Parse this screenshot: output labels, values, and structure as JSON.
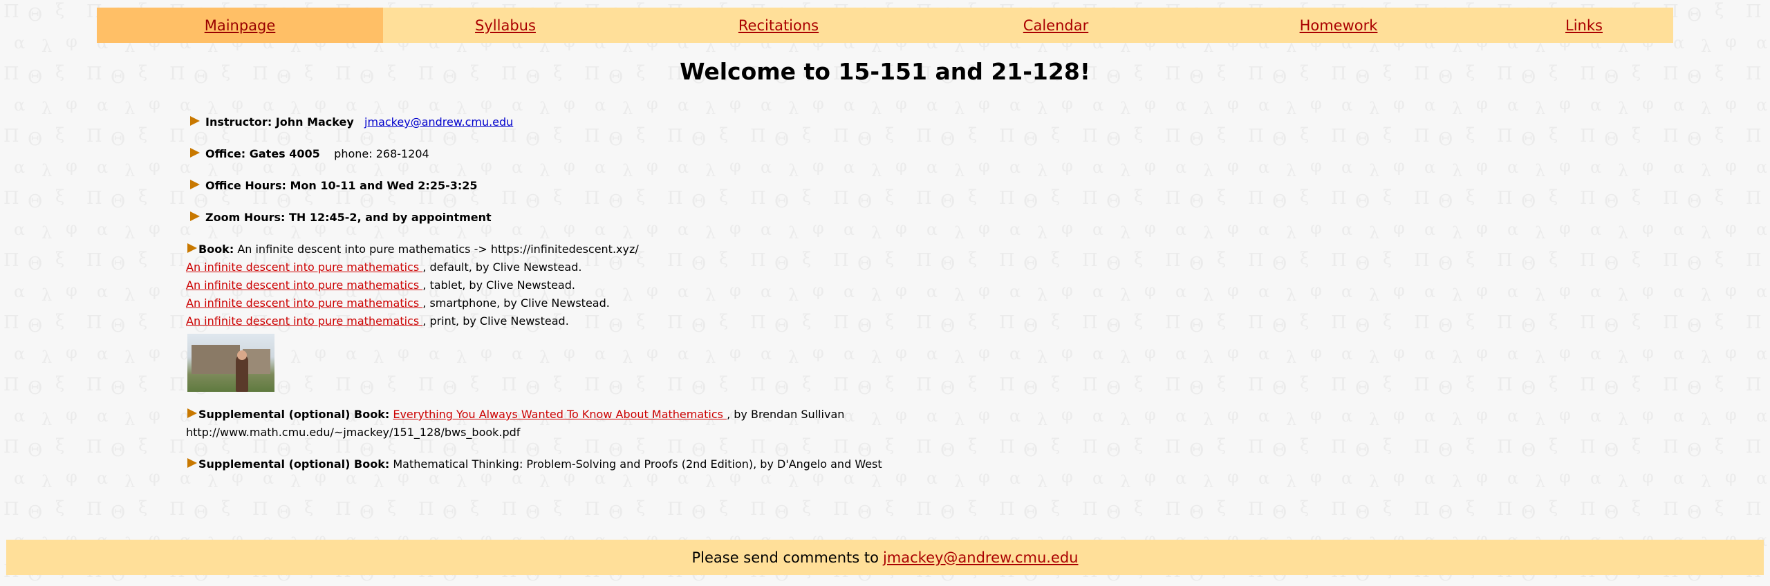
{
  "nav": {
    "items": [
      {
        "label": "Mainpage",
        "active": true
      },
      {
        "label": "Syllabus",
        "active": false
      },
      {
        "label": "Recitations",
        "active": false
      },
      {
        "label": "Calendar",
        "active": false
      },
      {
        "label": "Homework",
        "active": false
      },
      {
        "label": "Links",
        "active": false
      }
    ]
  },
  "page": {
    "title": "Welcome to 15-151 and 21-128!"
  },
  "info": {
    "instructor_label": "Instructor: John Mackey",
    "instructor_email": "jmackey@andrew.cmu.edu",
    "office_label": "Office: Gates 4005",
    "office_phone": "phone: 268-1204",
    "office_hours": "Office Hours: Mon 10-11 and Wed 2:25-3:25",
    "zoom_hours": "Zoom Hours: TH 12:45-2, and by appointment",
    "book_label": "Book:",
    "book_text": "An infinite descent into pure mathematics -> https://infinitedescent.xyz/",
    "book_links": [
      {
        "link": "An infinite descent into pure mathematics ",
        "suffix": ", default, by Clive Newstead."
      },
      {
        "link": "An infinite descent into pure mathematics ",
        "suffix": ", tablet, by Clive Newstead."
      },
      {
        "link": "An infinite descent into pure mathematics ",
        "suffix": ", smartphone, by Clive Newstead."
      },
      {
        "link": "An infinite descent into pure mathematics ",
        "suffix": ", print, by Clive Newstead."
      }
    ],
    "supp1_label": "Supplemental (optional) Book:",
    "supp1_link": "Everything You Always Wanted To Know About Mathematics ",
    "supp1_suffix": ", by Brendan Sullivan",
    "supp1_url": "http://www.math.cmu.edu/~jmackey/151_128/bws_book.pdf",
    "supp2_label": "Supplemental (optional) Book:",
    "supp2_text": "Mathematical Thinking: Problem-Solving and Proofs (2nd Edition), by D'Angelo and West"
  },
  "footer": {
    "text": "Please send comments to",
    "email": "jmackey@andrew.cmu.edu"
  },
  "colors": {
    "nav_bg": "#ffdf99",
    "nav_active_bg": "#ffbf66",
    "link_red": "#cc0000",
    "link_blue": "#0000cc",
    "bullet_arrow": "#c87800"
  }
}
